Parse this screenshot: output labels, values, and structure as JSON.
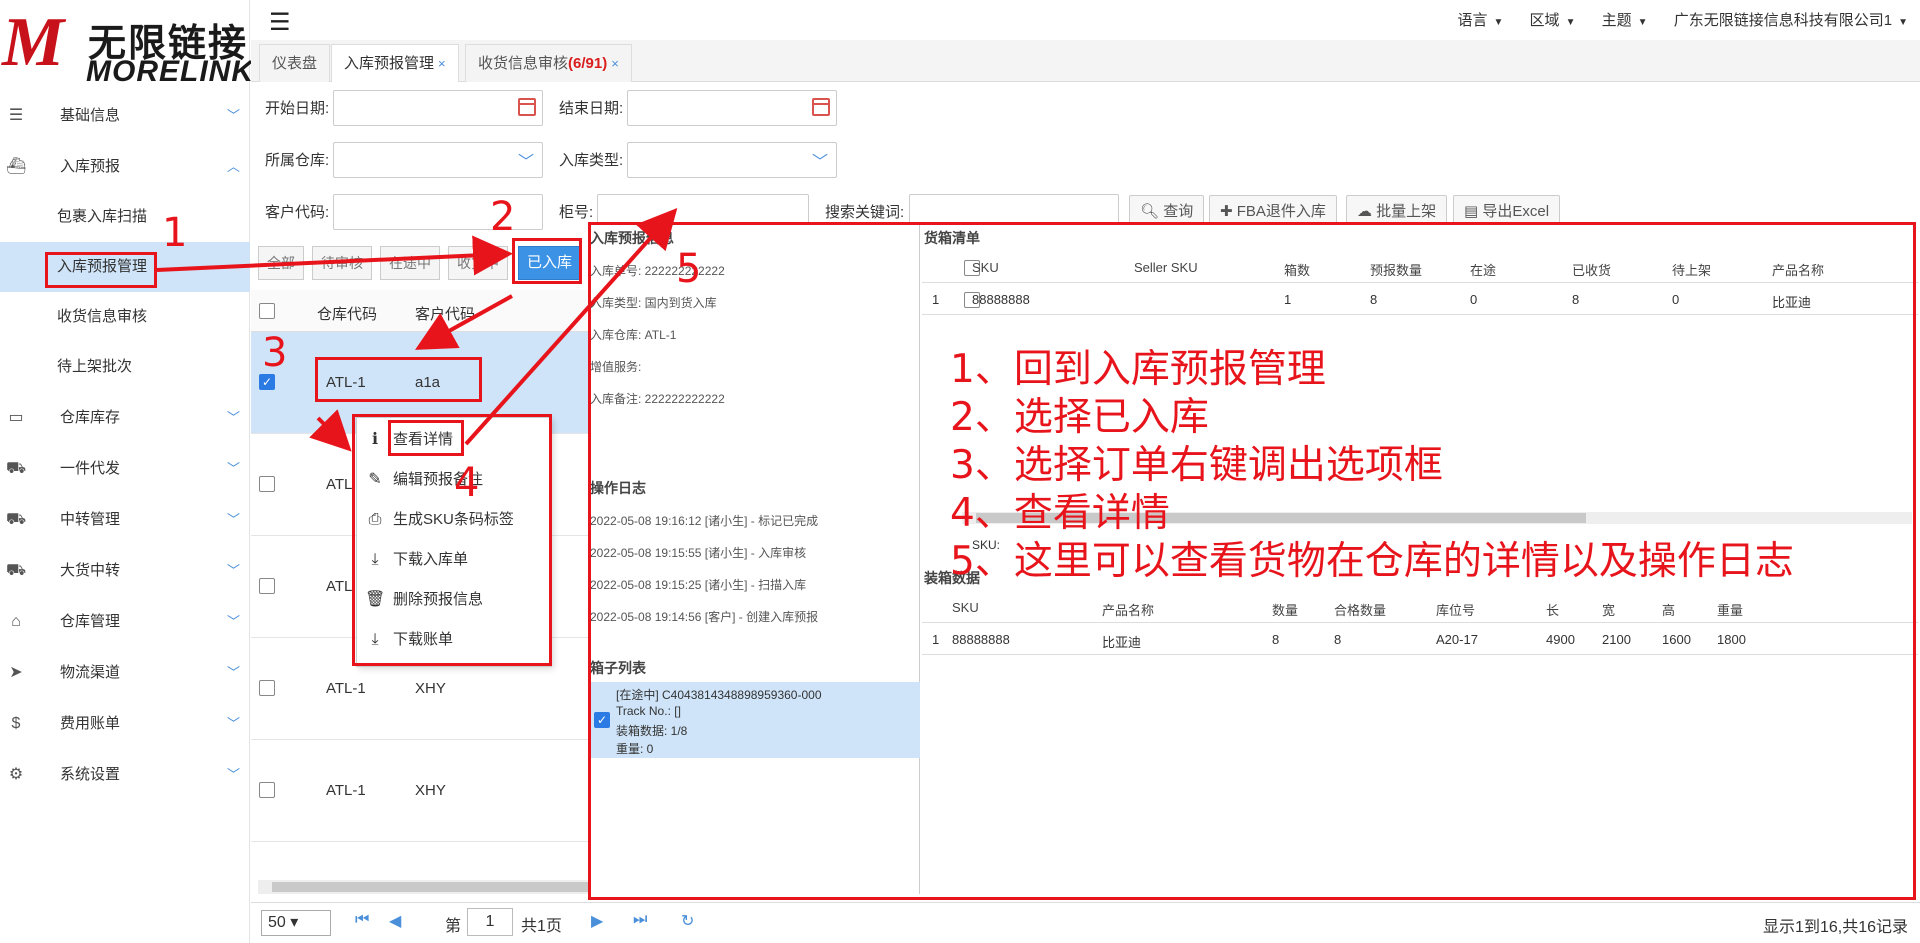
{
  "logo": {
    "mark": "M",
    "cn": "无限链接",
    "en": "MORELINK"
  },
  "sidebar": {
    "items": [
      {
        "label": "基础信息",
        "icon": "list-icon"
      },
      {
        "label": "入库预报",
        "icon": "ship-icon",
        "expanded": true
      },
      {
        "label": "包裹入库扫描",
        "sub": true
      },
      {
        "label": "入库预报管理",
        "sub": true,
        "active": true
      },
      {
        "label": "收货信息审核",
        "sub": true
      },
      {
        "label": "待上架批次",
        "sub": true
      },
      {
        "label": "仓库库存",
        "icon": "inbox-icon"
      },
      {
        "label": "一件代发",
        "icon": "truck-icon"
      },
      {
        "label": "中转管理",
        "icon": "truck-icon"
      },
      {
        "label": "大货中转",
        "icon": "truck-icon"
      },
      {
        "label": "仓库管理",
        "icon": "home-icon"
      },
      {
        "label": "物流渠道",
        "icon": "pointer-icon"
      },
      {
        "label": "费用账单",
        "icon": "dollar-icon"
      },
      {
        "label": "系统设置",
        "icon": "gear-icon"
      }
    ]
  },
  "header": {
    "menu": [
      "语言",
      "区域",
      "主题"
    ],
    "company": "广东无限链接信息科技有限公司1"
  },
  "tabs": {
    "dashboard": "仪表盘",
    "inbound": "入库预报管理",
    "receipt": "收货信息审核",
    "receipt_count": "(6/91)",
    "close": "×"
  },
  "form": {
    "start_date": "开始日期:",
    "end_date": "结束日期:",
    "warehouse": "所属仓库:",
    "inbound_type": "入库类型:",
    "customer_code": "客户代码:",
    "cabinet": "柜号:",
    "keyword": "搜索关键词:",
    "btn_query": "查询",
    "btn_fba": "FBA退件入库",
    "btn_batch": "批量上架",
    "btn_export": "导出Excel"
  },
  "status_chips": [
    "全部",
    "待审核",
    "在途中",
    "收货中",
    "已入库"
  ],
  "grid": {
    "headers": [
      "仓库代码",
      "客户代码"
    ],
    "rows": [
      {
        "wh": "ATL-1",
        "cust": "a1a"
      },
      {
        "wh": "ATL",
        "cust": ""
      },
      {
        "wh": "ATL",
        "cust": ""
      },
      {
        "wh": "ATL-1",
        "cust": "XHY"
      },
      {
        "wh": "ATL-1",
        "cust": "XHY"
      }
    ]
  },
  "context_menu": [
    "查看详情",
    "编辑预报备注",
    "生成SKU条码标签",
    "下载入库单",
    "删除预报信息",
    "下载账单"
  ],
  "pager": {
    "page_size": "50",
    "label_page": "第",
    "page": "1",
    "label_total": "共1页",
    "summary": "显示1到16,共16记录"
  },
  "detail": {
    "info_title": "入库预报信息",
    "info": [
      "入库单号: 222222222222",
      "入库类型: 国内到货入库",
      "入库仓库: ATL-1",
      "增值服务:",
      "入库备注: 222222222222"
    ],
    "log_title": "操作日志",
    "logs": [
      "2022-05-08 19:16:12 [诸小生] - 标记已完成",
      "2022-05-08 19:15:55 [诸小生] - 入库审核",
      "2022-05-08 19:15:25 [诸小生] - 扫描入库",
      "2022-05-08 19:14:56 [客户] - 创建入库预报"
    ],
    "box_title": "箱子列表",
    "box": [
      "[在途中] C4043814348898959360-000",
      "Track No.: []",
      "装箱数据: 1/8",
      "重量: 0"
    ],
    "cargo_title": "货箱清单",
    "cargo_headers": [
      "SKU",
      "Seller SKU",
      "箱数",
      "预报数量",
      "在途",
      "已收货",
      "待上架",
      "产品名称"
    ],
    "cargo_rows": [
      [
        "1",
        "88888888",
        "",
        "1",
        "8",
        "0",
        "8",
        "0",
        "比亚迪"
      ]
    ],
    "sku_label": "SKU:",
    "pack_title": "装箱数据",
    "pack_headers": [
      "SKU",
      "产品名称",
      "数量",
      "合格数量",
      "库位号",
      "长",
      "宽",
      "高",
      "重量"
    ],
    "pack_rows": [
      [
        "1",
        "88888888",
        "比亚迪",
        "8",
        "8",
        "A20-17",
        "4900",
        "2100",
        "1600",
        "1800"
      ]
    ]
  },
  "annotations": {
    "nums": [
      "1",
      "2",
      "3",
      "4",
      "5"
    ],
    "steps": [
      "1、回到入库预报管理",
      "2、选择已入库",
      "3、选择订单右键调出选项框",
      "4、查看详情",
      "5、这里可以查看货物在仓库的详情以及操作日志"
    ]
  }
}
